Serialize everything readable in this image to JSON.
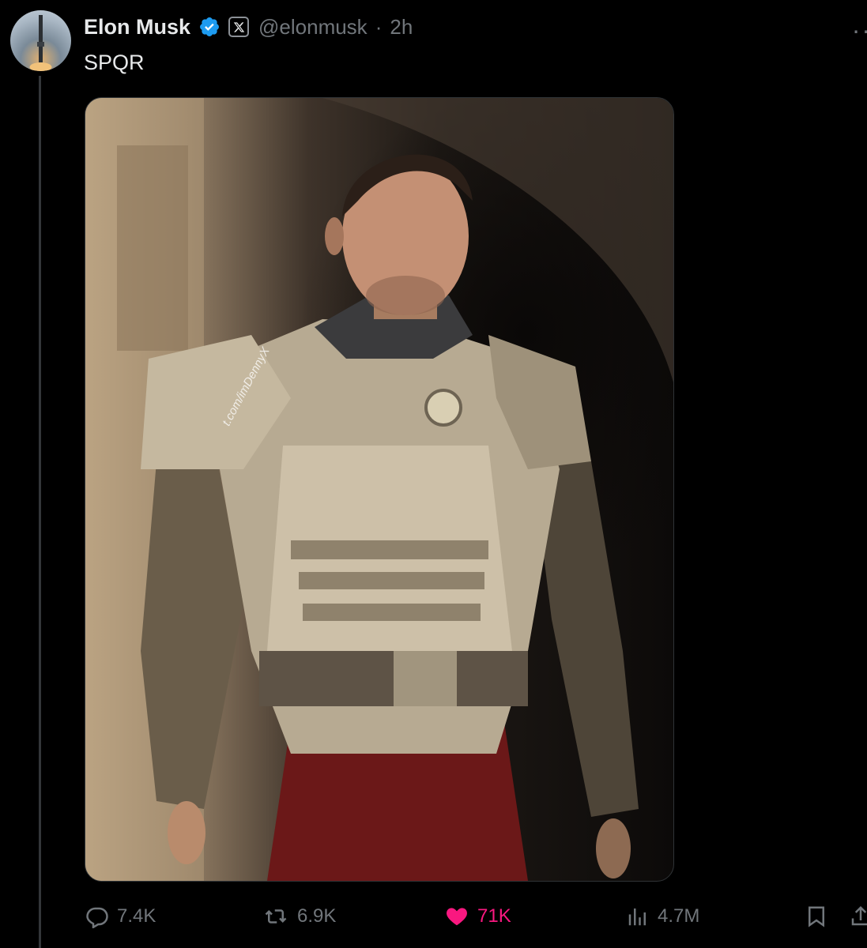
{
  "author": {
    "display_name": "Elon Musk",
    "handle": "@elonmusk",
    "separator": "·",
    "time": "2h",
    "verified_icon": "verified-badge-icon",
    "affiliate_icon": "x-logo-icon"
  },
  "tweet": {
    "text": "SPQR",
    "media_watermark": "t.com/imDennyX"
  },
  "actions": {
    "replies": "7.4K",
    "reposts": "6.9K",
    "likes": "71K",
    "views": "4.7M",
    "liked": true
  },
  "colors": {
    "background": "#000000",
    "text": "#e7e9ea",
    "muted": "#71767b",
    "verified": "#1d9bf0",
    "like": "#f91880"
  }
}
